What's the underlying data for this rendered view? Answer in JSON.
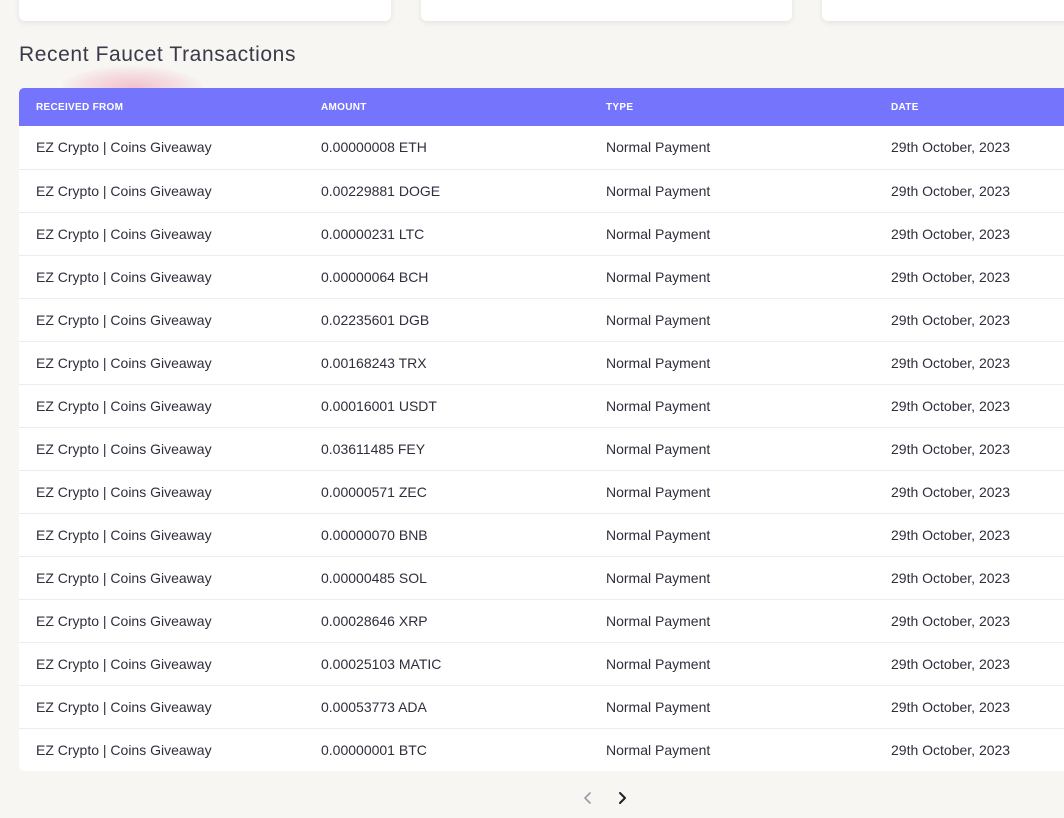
{
  "section": {
    "title": "Recent Faucet Transactions"
  },
  "table": {
    "columns": [
      "RECEIVED FROM",
      "AMOUNT",
      "TYPE",
      "DATE"
    ],
    "rows": [
      {
        "from": "EZ Crypto | Coins Giveaway",
        "amount": "0.00000008 ETH",
        "type": "Normal Payment",
        "date": "29th October, 2023"
      },
      {
        "from": "EZ Crypto | Coins Giveaway",
        "amount": "0.00229881 DOGE",
        "type": "Normal Payment",
        "date": "29th October, 2023"
      },
      {
        "from": "EZ Crypto | Coins Giveaway",
        "amount": "0.00000231 LTC",
        "type": "Normal Payment",
        "date": "29th October, 2023"
      },
      {
        "from": "EZ Crypto | Coins Giveaway",
        "amount": "0.00000064 BCH",
        "type": "Normal Payment",
        "date": "29th October, 2023"
      },
      {
        "from": "EZ Crypto | Coins Giveaway",
        "amount": "0.02235601 DGB",
        "type": "Normal Payment",
        "date": "29th October, 2023"
      },
      {
        "from": "EZ Crypto | Coins Giveaway",
        "amount": "0.00168243 TRX",
        "type": "Normal Payment",
        "date": "29th October, 2023"
      },
      {
        "from": "EZ Crypto | Coins Giveaway",
        "amount": "0.00016001 USDT",
        "type": "Normal Payment",
        "date": "29th October, 2023"
      },
      {
        "from": "EZ Crypto | Coins Giveaway",
        "amount": "0.03611485 FEY",
        "type": "Normal Payment",
        "date": "29th October, 2023"
      },
      {
        "from": "EZ Crypto | Coins Giveaway",
        "amount": "0.00000571 ZEC",
        "type": "Normal Payment",
        "date": "29th October, 2023"
      },
      {
        "from": "EZ Crypto | Coins Giveaway",
        "amount": "0.00000070 BNB",
        "type": "Normal Payment",
        "date": "29th October, 2023"
      },
      {
        "from": "EZ Crypto | Coins Giveaway",
        "amount": "0.00000485 SOL",
        "type": "Normal Payment",
        "date": "29th October, 2023"
      },
      {
        "from": "EZ Crypto | Coins Giveaway",
        "amount": "0.00028646 XRP",
        "type": "Normal Payment",
        "date": "29th October, 2023"
      },
      {
        "from": "EZ Crypto | Coins Giveaway",
        "amount": "0.00025103 MATIC",
        "type": "Normal Payment",
        "date": "29th October, 2023"
      },
      {
        "from": "EZ Crypto | Coins Giveaway",
        "amount": "0.00053773 ADA",
        "type": "Normal Payment",
        "date": "29th October, 2023"
      },
      {
        "from": "EZ Crypto | Coins Giveaway",
        "amount": "0.00000001 BTC",
        "type": "Normal Payment",
        "date": "29th October, 2023"
      }
    ]
  },
  "pagination": {
    "prev_icon": "chevron-left-icon",
    "next_icon": "chevron-right-icon"
  },
  "colors": {
    "header_bg": "#7574fc",
    "page_bg": "#f7f6f3",
    "card_bg": "#ffffff"
  }
}
